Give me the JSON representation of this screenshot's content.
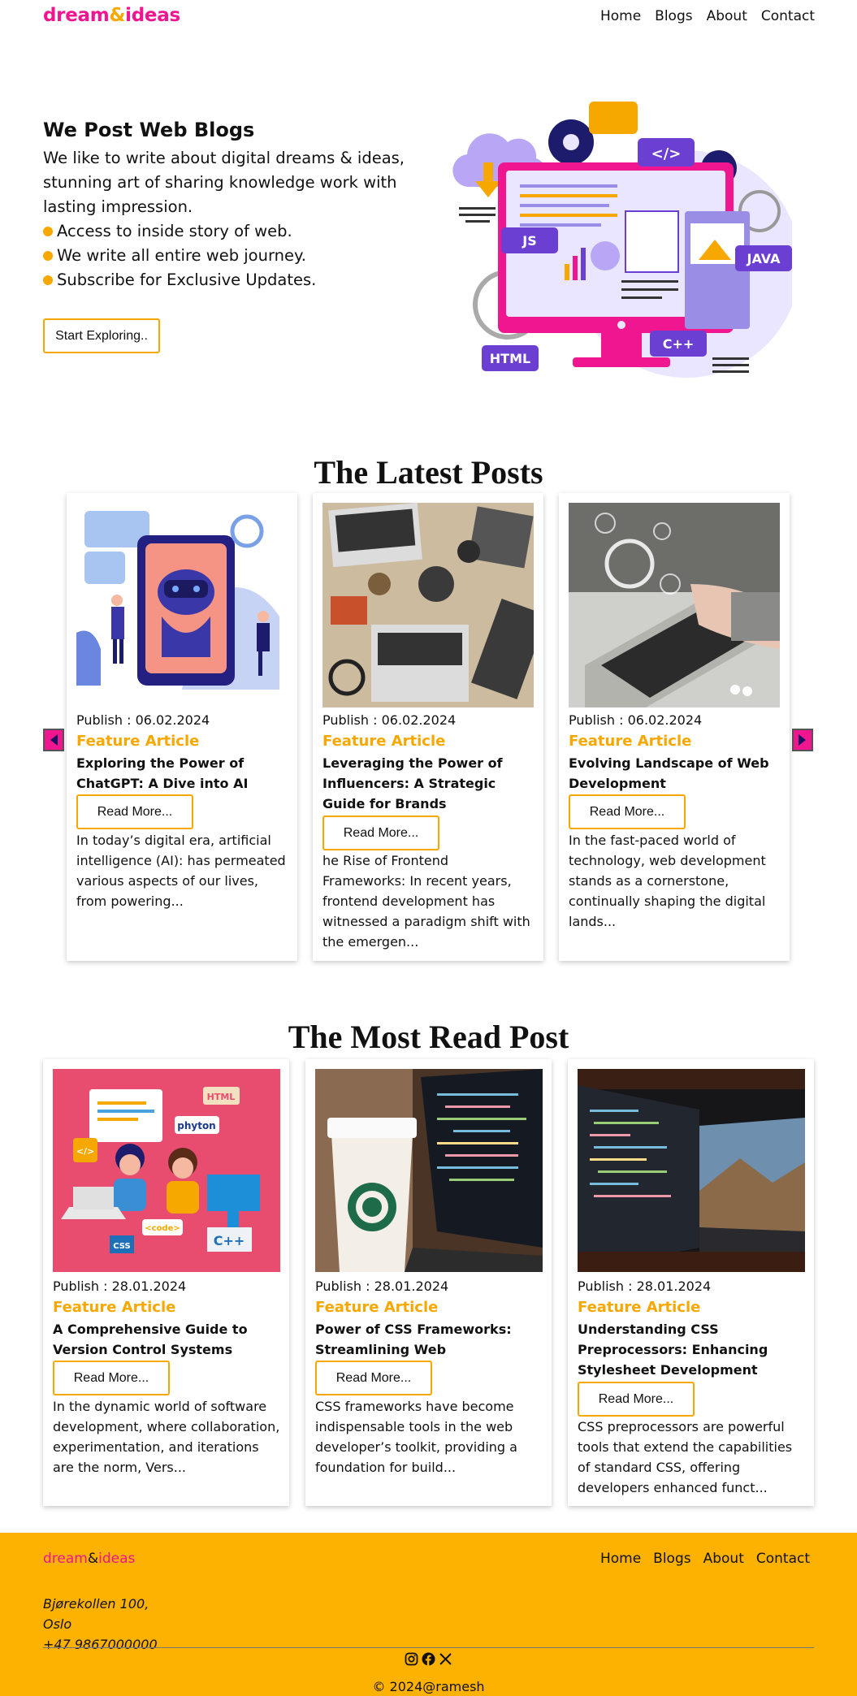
{
  "brand": {
    "part1": "dream",
    "amp": "&",
    "part2": "ideas"
  },
  "nav": {
    "home": "Home",
    "blogs": "Blogs",
    "about": "About",
    "contact": "Contact"
  },
  "hero": {
    "title": "We Post Web Blogs",
    "text": "We like to write about digital dreams & ideas, stunning art of sharing knowledge work with lasting impression.",
    "bullets": [
      "Access to inside story of web.",
      "We write all entire web journey.",
      "Subscribe for Exclusive Updates."
    ],
    "cta": "Start Exploring..",
    "art_labels": {
      "js": "JS",
      "java": "JAVA",
      "html": "HTML",
      "cpp": "C++",
      "code": "</>"
    }
  },
  "latest": {
    "title": "The Latest Posts",
    "cards": [
      {
        "publish": "Publish : 06.02.2024",
        "category": "Feature Article",
        "title": "Exploring the Power of ChatGPT: A Dive into AI",
        "button": "Read More...",
        "excerpt": "In today’s digital era, artificial intelligence (AI): has permeated various aspects of our lives, from powering..."
      },
      {
        "publish": "Publish : 06.02.2024",
        "category": "Feature Article",
        "title": "Leveraging the Power of Influencers: A Strategic Guide for Brands",
        "button": "Read More...",
        "excerpt": "he Rise of Frontend Frameworks: In recent years, frontend development has witnessed a paradigm shift with the emergen..."
      },
      {
        "publish": "Publish : 06.02.2024",
        "category": "Feature Article",
        "title": "Evolving Landscape of Web Development",
        "button": "Read More...",
        "excerpt": "In the fast-paced world of technology, web development stands as a cornerstone, continually shaping the digital lands..."
      }
    ]
  },
  "most_read": {
    "title": "The Most Read Post",
    "cards": [
      {
        "publish": "Publish : 28.01.2024",
        "category": "Feature Article",
        "title": "A Comprehensive Guide to Version Control Systems",
        "button": "Read More...",
        "excerpt": "In the dynamic world of software development, where collaboration, experimentation, and iterations are the norm, Vers...",
        "art": {
          "html": "HTML",
          "python": "phyton",
          "code": "<code>",
          "css": "CSS",
          "cpp": "C++",
          "tag": "</>"
        }
      },
      {
        "publish": "Publish : 28.01.2024",
        "category": "Feature Article",
        "title": "Power of CSS Frameworks: Streamlining Web Development",
        "button": "Read More...",
        "excerpt": "CSS frameworks have become indispensable tools in the web developer’s toolkit, providing a foundation for build..."
      },
      {
        "publish": "Publish : 28.01.2024",
        "category": "Feature Article",
        "title": "Understanding CSS Preprocessors: Enhancing Stylesheet Development",
        "button": "Read More...",
        "excerpt": "CSS preprocessors are powerful tools that extend the capabilities of standard CSS, offering developers enhanced funct..."
      }
    ]
  },
  "footer": {
    "brand": {
      "part1": "dream",
      "amp": "&",
      "part2": "ideas"
    },
    "links": {
      "home": "Home",
      "blogs": "Blogs",
      "about": "About",
      "contact": "Contact"
    },
    "address": [
      "Bjørekollen 100,",
      "Oslo",
      "+47 9867000000"
    ],
    "copyright": "© 2024@ramesh"
  },
  "colors": {
    "pink": "#f0168f",
    "orange": "#f7a800",
    "footer": "#fdb100",
    "purple": "#5b3cc4"
  },
  "icons": [
    "instagram-icon",
    "facebook-icon",
    "x-icon",
    "arrow-left-icon",
    "arrow-right-icon"
  ]
}
